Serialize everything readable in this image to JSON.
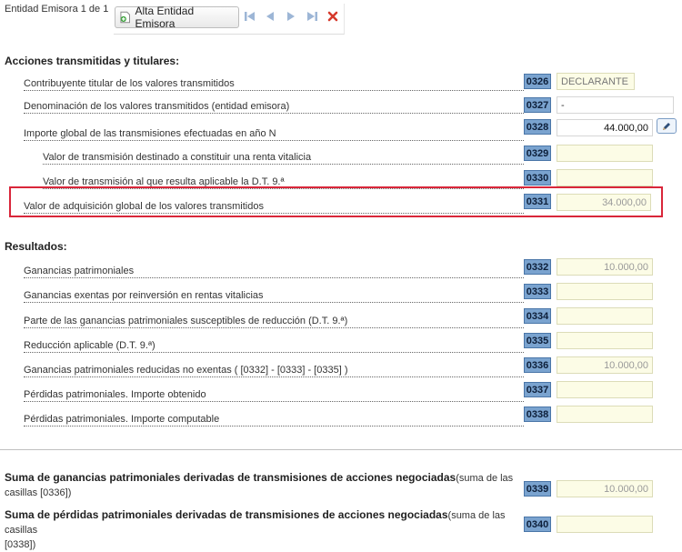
{
  "toolbar": {
    "entity_counter": "Entidad Emisora 1 de 1",
    "alta_label": "Alta Entidad Emisora",
    "icons": [
      "add-document-icon",
      "first-icon",
      "prev-icon",
      "next-icon",
      "last-icon",
      "delete-icon"
    ]
  },
  "section1": {
    "title": "Acciones transmitidas y titulares:",
    "rows": [
      {
        "label": "Contribuyente titular de los valores transmitidos",
        "code": "0326",
        "value": "DECLARANTE"
      },
      {
        "label": "Denominación de los valores transmitidos (entidad emisora)",
        "code": "0327",
        "value": "-"
      },
      {
        "label": "Importe global de las transmisiones efectuadas en año N",
        "code": "0328",
        "value": "44.000,00"
      },
      {
        "label": "Valor de transmisión destinado a constituir una renta vitalicia",
        "code": "0329",
        "value": ""
      },
      {
        "label": "Valor de transmisión al que resulta aplicable la D.T. 9.ª",
        "code": "0330",
        "value": ""
      },
      {
        "label": "Valor de adquisición global de los valores transmitidos",
        "code": "0331",
        "value": "34.000,00"
      }
    ]
  },
  "section2": {
    "title": "Resultados:",
    "rows": [
      {
        "label": "Ganancias patrimoniales",
        "code": "0332",
        "value": "10.000,00"
      },
      {
        "label": "Ganancias exentas por reinversión en rentas vitalicias",
        "code": "0333",
        "value": ""
      },
      {
        "label": "Parte de las ganancias patrimoniales susceptibles de reducción (D.T. 9.ª)",
        "code": "0334",
        "value": ""
      },
      {
        "label": "Reducción aplicable (D.T. 9.ª)",
        "code": "0335",
        "value": ""
      },
      {
        "label": "Ganancias patrimoniales reducidas no exentas ( [0332] - [0333] - [0335] )",
        "code": "0336",
        "value": "10.000,00"
      },
      {
        "label": "Pérdidas patrimoniales. Importe obtenido",
        "code": "0337",
        "value": ""
      },
      {
        "label": "Pérdidas patrimoniales. Importe computable",
        "code": "0338",
        "value": ""
      }
    ]
  },
  "totals": {
    "gains_bold": "Suma de ganancias patrimoniales derivadas de transmisiones de acciones negociadas",
    "gains_note1": "(suma de las",
    "gains_note2": "casillas [0336])",
    "gains_code": "0339",
    "gains_value": "10.000,00",
    "losses_bold": "Suma de pérdidas patrimoniales derivadas de transmisiones de acciones negociadas",
    "losses_note1": "(suma de las casillas",
    "losses_note2": "[0338])",
    "losses_code": "0340",
    "losses_value": ""
  },
  "colors": {
    "highlight": "#d9263a",
    "code_bg": "#7aa3cf",
    "field_bg": "#fcfce6"
  }
}
